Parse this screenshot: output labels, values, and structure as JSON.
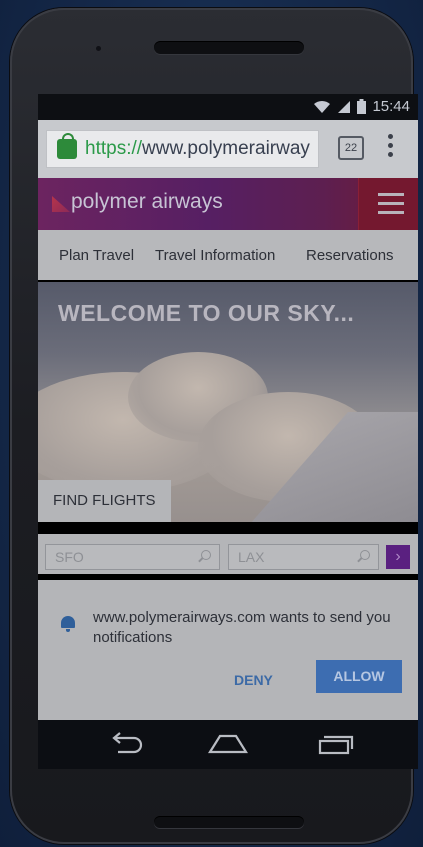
{
  "status_bar": {
    "time": "15:44"
  },
  "browser": {
    "url_scheme": "https://",
    "url_host": "www.polymerairway",
    "tab_count": "22"
  },
  "site": {
    "brand": "polymer airways",
    "nav": [
      "Plan Travel",
      "Travel Information",
      "Reservations"
    ],
    "hero_title": "WELCOME TO OUR SKY...",
    "find_flights_label": "FIND FLIGHTS",
    "from_value": "SFO",
    "to_value": "LAX",
    "go_label": "›"
  },
  "notification": {
    "message": "www.polymerairways.com wants to send you notifications",
    "deny_label": "DENY",
    "allow_label": "ALLOW"
  },
  "colors": {
    "accent_purple": "#5a2080",
    "allow_blue": "#3d6db1",
    "secure_green": "#2d8a3a"
  },
  "icons": {
    "lock": "lock-icon",
    "bell": "bell-icon",
    "search": "search-icon",
    "menu": "hamburger-icon",
    "back": "back-icon",
    "home": "home-icon",
    "recents": "recents-icon"
  }
}
